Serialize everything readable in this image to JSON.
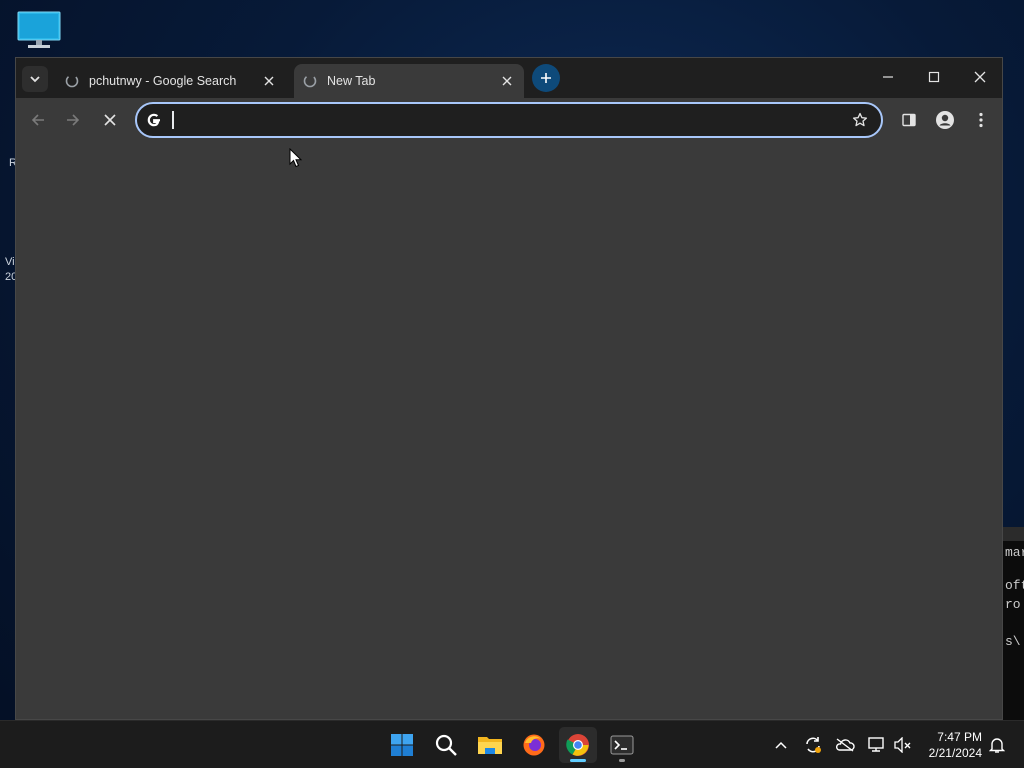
{
  "desktop": {
    "edge_text": [
      "R",
      "Vi",
      "20"
    ],
    "terminal_fragments": [
      "mar",
      "oft",
      "ro",
      "s\\"
    ]
  },
  "browser": {
    "tabs": [
      {
        "title": "pchutnwy - Google Search",
        "favicon": "loading-spinner-icon",
        "active": false
      },
      {
        "title": "New Tab",
        "favicon": "loading-spinner-icon",
        "active": true
      }
    ],
    "omnibox": {
      "value": "",
      "placeholder": ""
    },
    "colors": {
      "focus_ring": "#a8c7fa",
      "new_tab_button": "#0e4a7a",
      "page_bg": "#3a3a3a",
      "tab_strip": "#1f1f1f"
    }
  },
  "taskbar": {
    "apps": [
      {
        "name": "start-button",
        "icon": "windows-logo-icon"
      },
      {
        "name": "search-button",
        "icon": "search-icon"
      },
      {
        "name": "file-explorer",
        "icon": "folder-icon"
      },
      {
        "name": "firefox",
        "icon": "firefox-icon"
      },
      {
        "name": "chrome",
        "icon": "chrome-icon",
        "active": true
      },
      {
        "name": "terminal",
        "icon": "terminal-icon"
      }
    ],
    "clock": {
      "time": "7:47 PM",
      "date": "2/21/2024"
    }
  }
}
